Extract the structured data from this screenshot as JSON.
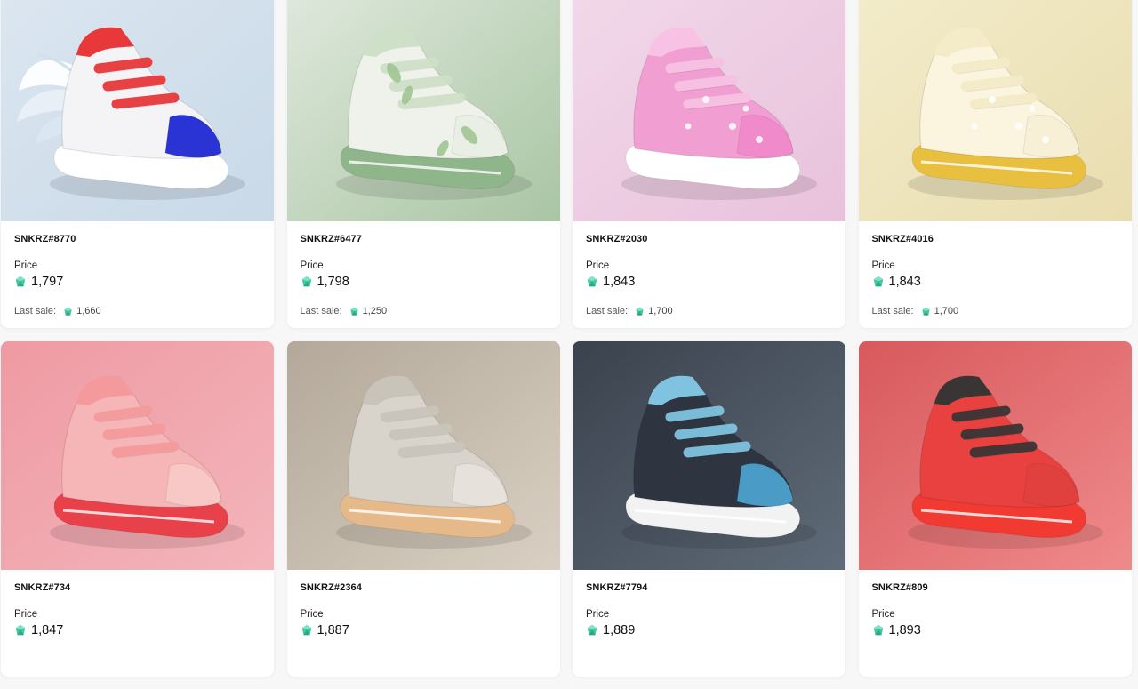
{
  "currency_icon": "gem-icon",
  "accent": "#3fc8a0",
  "cards": [
    {
      "name": "SNKRZ#8770",
      "price_label": "Price",
      "price": "1,797",
      "last_label": "Last sale:",
      "last_sale": "1,660",
      "bg_top": "#dbe6f0",
      "bg_bottom": "#c9d9e8",
      "shoe_main": "#f4f4f6",
      "shoe_accent": "#e8383a",
      "shoe_toe": "#2a33d4",
      "sole": "#ffffff",
      "variant": "wing"
    },
    {
      "name": "SNKRZ#6477",
      "price_label": "Price",
      "price": "1,798",
      "last_label": "Last sale:",
      "last_sale": "1,250",
      "bg_top": "#dfe8dc",
      "bg_bottom": "#a9c5a3",
      "shoe_main": "#eef2ea",
      "shoe_accent": "#cfe0c8",
      "shoe_toe": "#e9efe4",
      "sole": "#8fb58a",
      "variant": "leaf"
    },
    {
      "name": "SNKRZ#2030",
      "price_label": "Price",
      "price": "1,843",
      "last_label": "Last sale:",
      "last_sale": "1,700",
      "bg_top": "#f2d8ea",
      "bg_bottom": "#e8c2db",
      "shoe_main": "#f19fd2",
      "shoe_accent": "#f7c2e3",
      "shoe_toe": "#f08acb",
      "sole": "#ffffff",
      "variant": "flower"
    },
    {
      "name": "SNKRZ#4016",
      "price_label": "Price",
      "price": "1,843",
      "last_label": "Last sale:",
      "last_sale": "1,700",
      "bg_top": "#f3ecca",
      "bg_bottom": "#e9ddb0",
      "shoe_main": "#fbf5df",
      "shoe_accent": "#f4ecc8",
      "shoe_toe": "#f7f0d6",
      "sole": "#e8bf3e",
      "variant": "flower"
    },
    {
      "name": "SNKRZ#734",
      "price_label": "Price",
      "price": "1,847",
      "last_label": "",
      "last_sale": "",
      "bg_top": "#ef9aa3",
      "bg_bottom": "#f3b5bb",
      "shoe_main": "#f6b6b8",
      "shoe_accent": "#f49a9c",
      "shoe_toe": "#f8c8c6",
      "sole": "#e8414a",
      "variant": "strap"
    },
    {
      "name": "SNKRZ#2364",
      "price_label": "Price",
      "price": "1,887",
      "last_label": "",
      "last_sale": "",
      "bg_top": "#b3a899",
      "bg_bottom": "#d9d0c3",
      "shoe_main": "#d8d4cc",
      "shoe_accent": "#c9c4ba",
      "shoe_toe": "#e6e2db",
      "sole": "#e6b98a",
      "variant": "strap"
    },
    {
      "name": "SNKRZ#7794",
      "price_label": "Price",
      "price": "1,889",
      "last_label": "",
      "last_sale": "",
      "bg_top": "#3a424d",
      "bg_bottom": "#5f6b78",
      "shoe_main": "#2e3540",
      "shoe_accent": "#7fc3e0",
      "shoe_toe": "#4a9cc6",
      "sole": "#f2f2f2",
      "variant": "strap"
    },
    {
      "name": "SNKRZ#809",
      "price_label": "Price",
      "price": "1,893",
      "last_label": "",
      "last_sale": "",
      "bg_top": "#d8595c",
      "bg_bottom": "#ef8a8b",
      "shoe_main": "#e8413f",
      "shoe_accent": "#3a3535",
      "shoe_toe": "#e0413e",
      "sole": "#f03a32",
      "variant": "lace"
    }
  ]
}
